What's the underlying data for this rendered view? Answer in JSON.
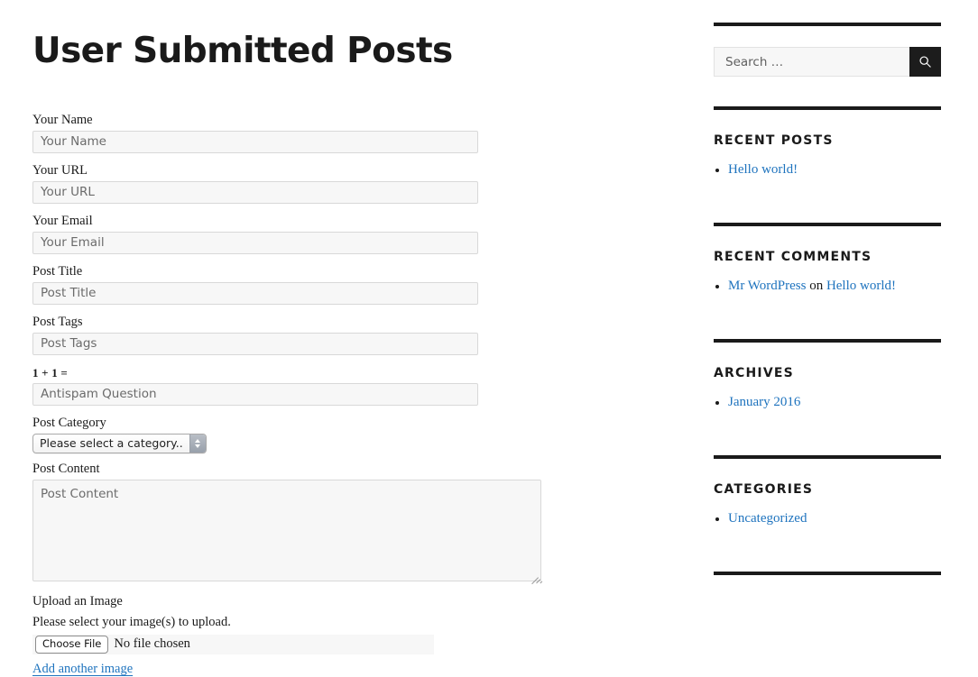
{
  "page": {
    "title": "User Submitted Posts"
  },
  "form": {
    "fields": [
      {
        "label": "Your Name",
        "placeholder": "Your Name",
        "name": "your-name"
      },
      {
        "label": "Your URL",
        "placeholder": "Your URL",
        "name": "your-url"
      },
      {
        "label": "Your Email",
        "placeholder": "Your Email",
        "name": "your-email"
      },
      {
        "label": "Post Title",
        "placeholder": "Post Title",
        "name": "post-title"
      },
      {
        "label": "Post Tags",
        "placeholder": "Post Tags",
        "name": "post-tags"
      }
    ],
    "antispam": {
      "label": "1 + 1 =",
      "placeholder": "Antispam Question"
    },
    "category": {
      "label": "Post Category",
      "selected": "Please select a category..",
      "arrow_icon": "updown-arrows-icon"
    },
    "content": {
      "label": "Post Content",
      "placeholder": "Post Content",
      "resize_icon": "resize-grip-icon"
    },
    "upload": {
      "label": "Upload an Image",
      "hint": "Please select your image(s) to upload.",
      "choose_button": "Choose File",
      "file_status": "No file chosen",
      "add_another": "Add another image"
    }
  },
  "sidebar": {
    "search": {
      "placeholder": "Search …",
      "value": "",
      "button_icon": "search-icon"
    },
    "widgets": [
      {
        "title": "Recent Posts",
        "name": "recent-posts",
        "items": [
          {
            "link": "Hello world!"
          }
        ]
      },
      {
        "title": "Recent Comments",
        "name": "recent-comments",
        "items": [
          {
            "link": "Mr WordPress",
            "middle": " on ",
            "link2": "Hello world!"
          }
        ]
      },
      {
        "title": "Archives",
        "name": "archives",
        "items": [
          {
            "link": "January 2016"
          }
        ]
      },
      {
        "title": "Categories",
        "name": "categories",
        "items": [
          {
            "link": "Uncategorized"
          }
        ]
      }
    ]
  },
  "colors": {
    "link": "#1e73be",
    "text": "#1a1a1a",
    "rule": "#1a1a1a",
    "input_bg": "#f7f7f7",
    "button_bg": "#1c1c1c"
  }
}
